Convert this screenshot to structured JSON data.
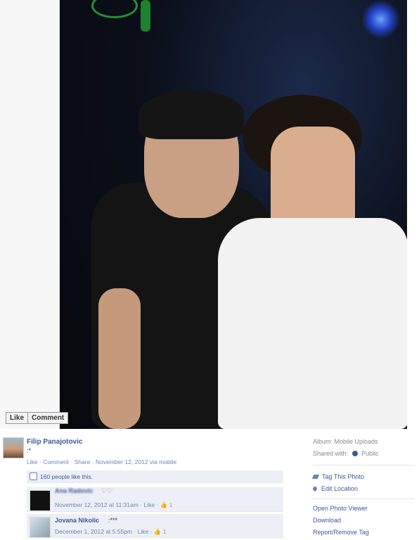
{
  "photo_actions": {
    "like_label": "Like",
    "comment_label": "Comment"
  },
  "post": {
    "author": "Filip Panajotovic",
    "caption": ":*",
    "meta": {
      "like": "Like",
      "comment": "Comment",
      "share": "Share",
      "date": "November 12, 2012 via mobile",
      "sep": "·"
    },
    "likes_text": "160 people like this."
  },
  "comments": [
    {
      "name": "Ana Radovic",
      "text": "♡♡",
      "date": "November 12, 2012 at 11:31am",
      "like": "Like",
      "count": "1"
    },
    {
      "name": "Jovana Nikolic",
      "text": ":***",
      "date": "December 1, 2012 at 5:55pm",
      "like": "Like",
      "count": "1"
    }
  ],
  "sidebar": {
    "album": "Album: Mobile Uploads",
    "shared_with_label": "Shared with:",
    "shared_with_value": "Public",
    "tag_photo": "Tag This Photo",
    "edit_location": "Edit Location",
    "open_viewer": "Open Photo Viewer",
    "download": "Download",
    "report": "Report/Remove Tag"
  },
  "colors": {
    "link": "#3b5998",
    "comment_bg": "#eceff5",
    "muted": "#999999"
  }
}
